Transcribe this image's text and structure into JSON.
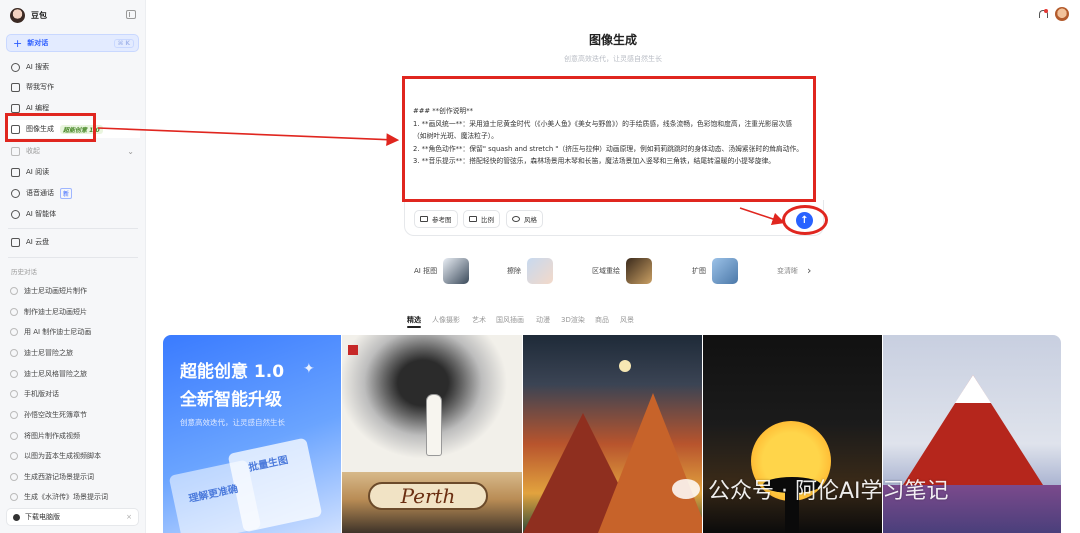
{
  "app": {
    "name": "豆包"
  },
  "sidebar": {
    "new_chat": {
      "label": "新对话",
      "shortcut": "⌘ K"
    },
    "items": [
      {
        "label": "AI 搜索"
      },
      {
        "label": "帮我写作"
      },
      {
        "label": "AI 编程"
      },
      {
        "label": "图像生成",
        "tag": "超能创意 1.0"
      },
      {
        "label": "收起"
      },
      {
        "label": "AI 阅读"
      },
      {
        "label": "语音通话",
        "badge": "新"
      },
      {
        "label": "AI 智能体"
      },
      {
        "label": "AI 云盘"
      }
    ],
    "history_title": "历史对话",
    "history": [
      "迪士尼动画短片制作",
      "制作迪士尼动画短片",
      "用 AI 制作迪士尼动画",
      "迪士尼冒险之旅",
      "迪士尼风格冒险之旅",
      "手机版对话",
      "孙悟空改生死簿章节",
      "将图片制作成视频",
      "以图为蓝本生成视频脚本",
      "生成西游记场景提示词",
      "生成《水浒传》场景提示词"
    ],
    "download": "下载电脑版"
  },
  "main": {
    "title": "图像生成",
    "subtitle": "创意高效迭代，让灵感自然生长",
    "prompt_text": "### **创作说明**\n1. **画风统一**：采用迪士尼黄金时代（《小美人鱼》《美女与野兽》）的手绘质感，线条流畅，色彩饱和度高，注重光影层次感（如树叶光斑、魔法粒子）。\n2. **角色动作**：保留\" squash and stretch \"（挤压与拉伸）动画原理，例如莉莉跳跳时的身体动态、汤姆紧张时的耸肩动作。\n3. **音乐提示**：搭配轻快的管弦乐，森林场景用木琴和长笛，魔法场景加入竖琴和三角铁，结尾转温暖的小提琴旋律。",
    "tools": [
      "参考图",
      "比例",
      "风格"
    ],
    "quick_tools": [
      "AI 抠图",
      "擦除",
      "区域重绘",
      "扩图",
      "变清晰"
    ],
    "categories": [
      "精选",
      "人像摄影",
      "艺术",
      "国风插画",
      "动漫",
      "3D渲染",
      "商品",
      "风景"
    ]
  },
  "gallery": {
    "promo": {
      "title_line1": "超能创意 1.0",
      "title_line2": "全新智能升级",
      "subtitle": "创意高效迭代，让灵感自然生长",
      "card1": "理解更准确",
      "card2": "批量生图"
    },
    "perth_sign": "Perth"
  },
  "watermark": "公众号 · 阿伦AI学习笔记",
  "colors": {
    "accent": "#2962ff",
    "annotation": "#e0261f"
  }
}
